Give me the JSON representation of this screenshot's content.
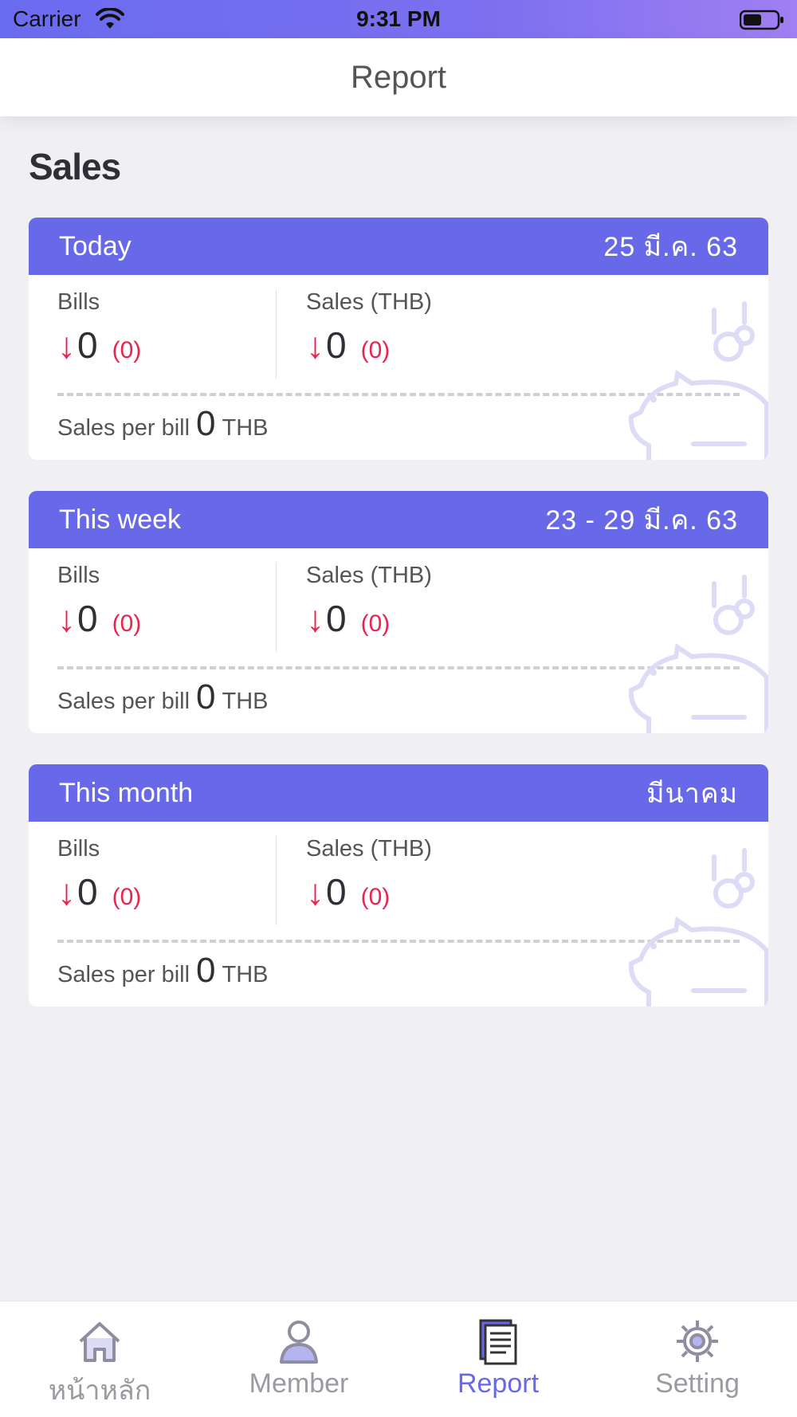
{
  "status_bar": {
    "carrier": "Carrier",
    "time": "9:31 PM"
  },
  "nav": {
    "title": "Report"
  },
  "section_title": "Sales",
  "labels": {
    "bills": "Bills",
    "sales": "Sales (THB)",
    "sales_per_bill": "Sales per bill",
    "unit": "THB",
    "arrow": "↓"
  },
  "cards": [
    {
      "title": "Today",
      "date": "25 มี.ค. 63",
      "bills_value": "0",
      "bills_delta": "(0)",
      "sales_value": "0",
      "sales_delta": "(0)",
      "per_bill_value": "0"
    },
    {
      "title": "This week",
      "date": "23 - 29 มี.ค. 63",
      "bills_value": "0",
      "bills_delta": "(0)",
      "sales_value": "0",
      "sales_delta": "(0)",
      "per_bill_value": "0"
    },
    {
      "title": "This month",
      "date": "มีนาคม",
      "bills_value": "0",
      "bills_delta": "(0)",
      "sales_value": "0",
      "sales_delta": "(0)",
      "per_bill_value": "0"
    }
  ],
  "tabs": [
    {
      "label": "หน้าหลัก",
      "icon": "home-icon"
    },
    {
      "label": "Member",
      "icon": "person-icon"
    },
    {
      "label": "Report",
      "icon": "report-icon",
      "active": true
    },
    {
      "label": "Setting",
      "icon": "gear-icon"
    }
  ],
  "colors": {
    "accent": "#6769e8",
    "negative": "#e8254f",
    "background": "#f0f0f4"
  }
}
